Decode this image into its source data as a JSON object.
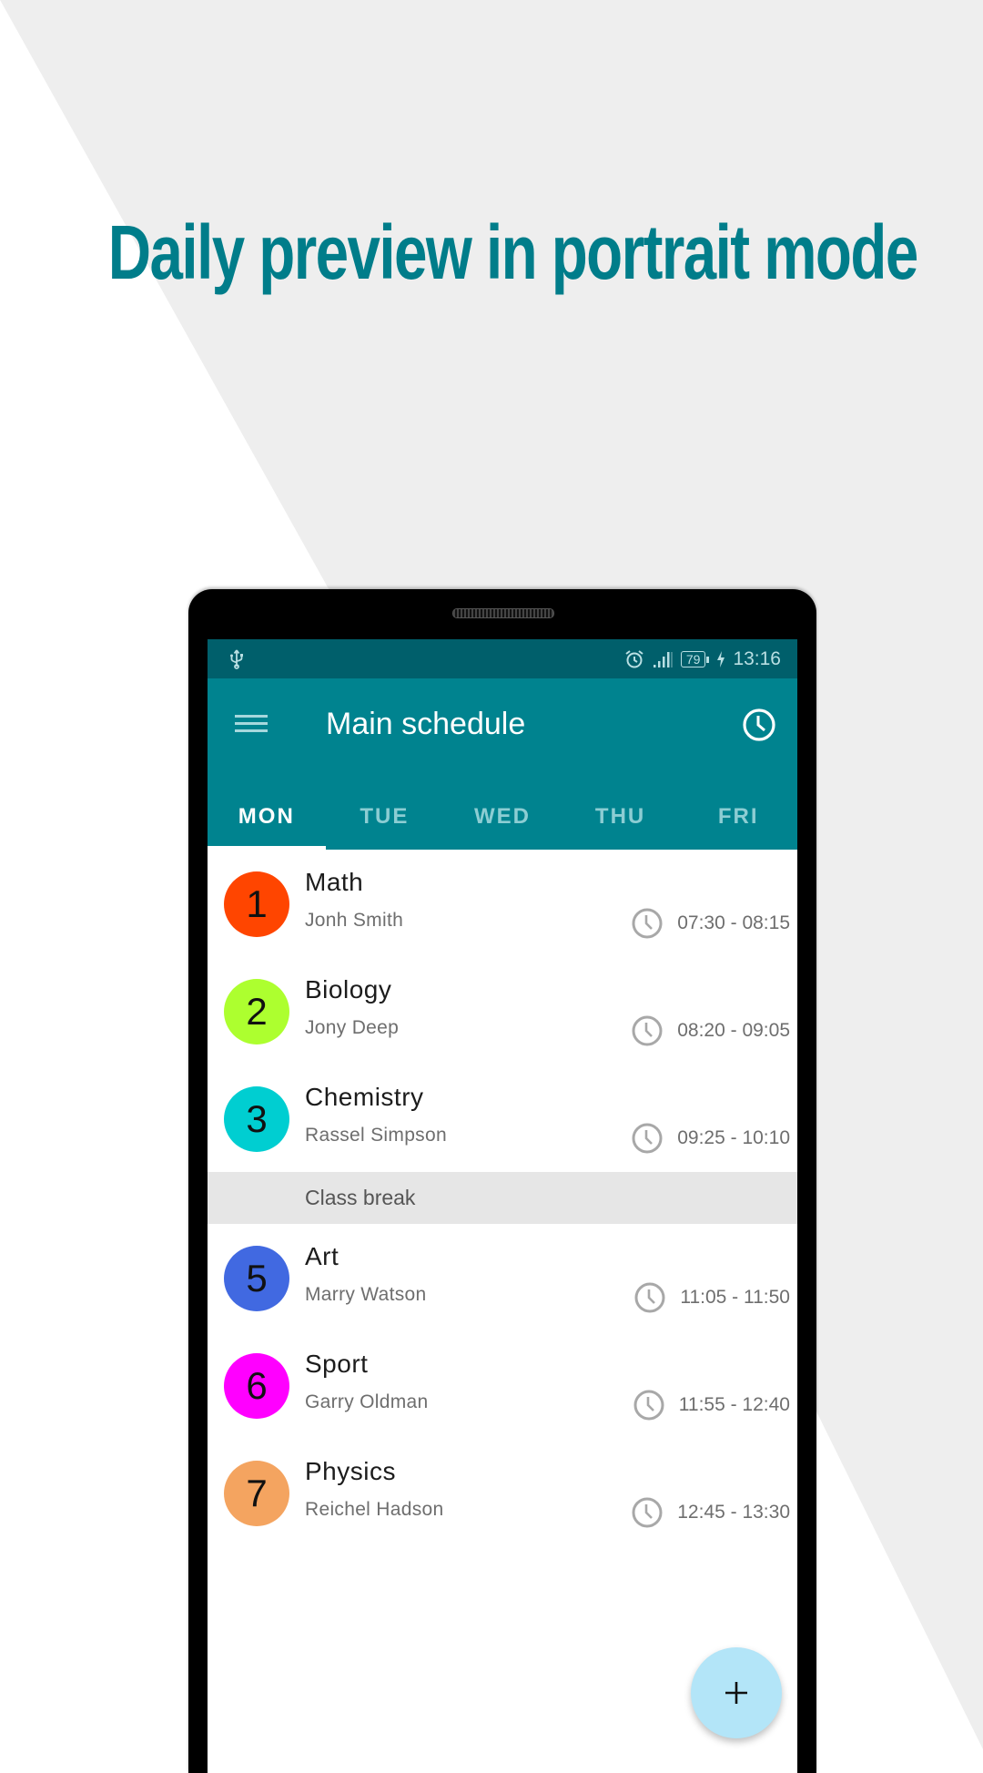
{
  "promo": {
    "title": "Daily preview in portrait mode",
    "accent_color": "#007d8a",
    "background_color": "#eeeeee"
  },
  "status_bar": {
    "left_icons": [
      "usb-icon"
    ],
    "right_icons": [
      "alarm-icon",
      "signal-icon",
      "battery-icon",
      "charging-icon"
    ],
    "battery_level": "79",
    "time": "13:16"
  },
  "app_bar": {
    "menu_icon": "hamburger-menu-icon",
    "title": "Main schedule",
    "action_icon": "clock-icon",
    "color": "#00838f",
    "status_color": "#005f6b"
  },
  "tabs": [
    {
      "label": "MON",
      "active": true
    },
    {
      "label": "TUE",
      "active": false
    },
    {
      "label": "WED",
      "active": false
    },
    {
      "label": "THU",
      "active": false
    },
    {
      "label": "FRI",
      "active": false
    }
  ],
  "schedule": [
    {
      "number": "1",
      "subject": "Math",
      "teacher": "Jonh Smith",
      "time": "07:30 - 08:15",
      "color": "#ff4500"
    },
    {
      "number": "2",
      "subject": "Biology",
      "teacher": "Jony Deep",
      "time": "08:20 - 09:05",
      "color": "#adff2f"
    },
    {
      "number": "3",
      "subject": "Chemistry",
      "teacher": "Rassel Simpson",
      "time": "09:25 - 10:10",
      "color": "#00ced1"
    },
    {
      "break_label": "Class break"
    },
    {
      "number": "5",
      "subject": "Art",
      "teacher": "Marry Watson",
      "time": "11:05 - 11:50",
      "color": "#4169e1"
    },
    {
      "number": "6",
      "subject": "Sport",
      "teacher": "Garry Oldman",
      "time": "11:55 - 12:40",
      "color": "#ff00ff"
    },
    {
      "number": "7",
      "subject": "Physics",
      "teacher": "Reichel Hadson",
      "time": "12:45 - 13:30",
      "color": "#f4a460"
    }
  ],
  "fab": {
    "icon": "plus-icon",
    "label": "+"
  }
}
